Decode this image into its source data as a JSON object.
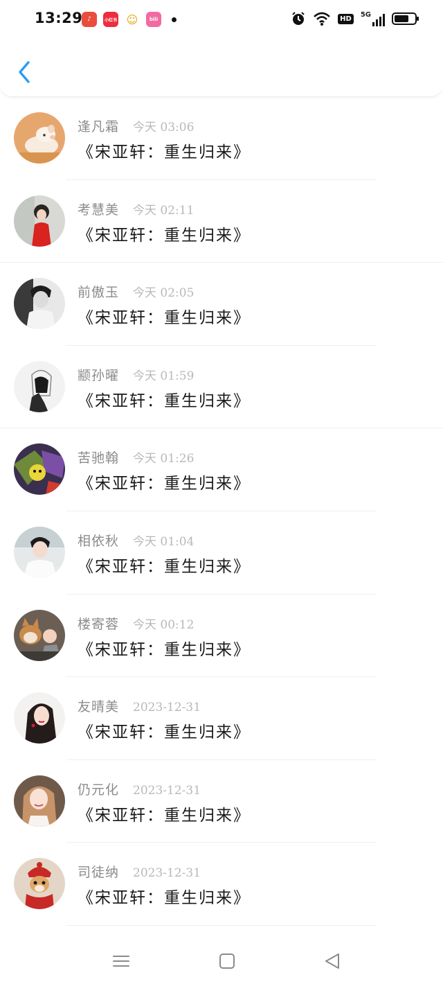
{
  "status_bar": {
    "time": "13:29",
    "apps": [
      {
        "name": "tiktok-app-icon",
        "color": "#e94d3c",
        "glyph": "♪"
      },
      {
        "name": "xiaohongshu-app-icon",
        "color": "#ee2d3d",
        "glyph": "小红书"
      },
      {
        "name": "qq-app-icon",
        "color": "#f4c12f",
        "glyph": "☺"
      },
      {
        "name": "bilibili-app-icon",
        "color": "#f26aa1",
        "glyph": "bili"
      }
    ],
    "system_icons": [
      "alarm-icon",
      "wifi-icon",
      "hd-icon",
      "signal-5g-icon",
      "battery-icon"
    ],
    "hd_label": "HD",
    "network_label": "5G"
  },
  "nav": {
    "back_icon": "chevron-left-icon",
    "accent": "#2a9df4"
  },
  "list": [
    {
      "name": "逢凡霜",
      "time": "今天 03:06",
      "title": "《宋亚轩：重生归来》",
      "avatar": "pig-avatar"
    },
    {
      "name": "考慧美",
      "time": "今天 02:11",
      "title": "《宋亚轩：重生归来》",
      "avatar": "girl-red-dress-avatar"
    },
    {
      "name": "前傲玉",
      "time": "今天 02:05",
      "title": "《宋亚轩：重生归来》",
      "avatar": "boy-bw-avatar"
    },
    {
      "name": "颛孙曜",
      "time": "今天 01:59",
      "title": "《宋亚轩：重生归来》",
      "avatar": "sketch-hood-avatar"
    },
    {
      "name": "苦驰翰",
      "time": "今天 01:26",
      "title": "《宋亚轩：重生归来》",
      "avatar": "cartoon-colorful-avatar"
    },
    {
      "name": "相依秋",
      "time": "今天 01:04",
      "title": "《宋亚轩：重生归来》",
      "avatar": "boy-white-shirt-avatar"
    },
    {
      "name": "楼寄蓉",
      "time": "今天 00:12",
      "title": "《宋亚轩：重生归来》",
      "avatar": "dog-baby-avatar"
    },
    {
      "name": "友晴美",
      "time": "2023-12-31",
      "title": "《宋亚轩：重生归来》",
      "avatar": "girl-long-hair-avatar"
    },
    {
      "name": "仍元化",
      "time": "2023-12-31",
      "title": "《宋亚轩：重生归来》",
      "avatar": "girl-smiling-avatar"
    },
    {
      "name": "司徒纳",
      "time": "2023-12-31",
      "title": "《宋亚轩：重生归来》",
      "avatar": "dog-red-hat-avatar"
    }
  ],
  "bottom_nav": [
    "menu-icon",
    "home-square-icon",
    "back-triangle-icon"
  ]
}
